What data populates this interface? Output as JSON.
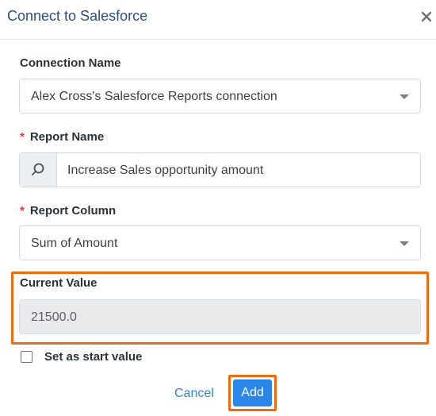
{
  "dialog": {
    "title": "Connect to Salesforce"
  },
  "form": {
    "connection": {
      "label": "Connection Name",
      "value": "Alex Cross's Salesforce Reports connection"
    },
    "report_name": {
      "required_mark": "*",
      "label": "Report Name",
      "value": "Increase Sales opportunity amount"
    },
    "report_column": {
      "required_mark": "*",
      "label": "Report Column",
      "value": "Sum of Amount"
    },
    "current_value": {
      "label": "Current Value",
      "value": "21500.0"
    },
    "start_value": {
      "label": "Set as start value",
      "checked": false
    }
  },
  "actions": {
    "cancel_label": "Cancel",
    "add_label": "Add"
  },
  "colors": {
    "accent": "#2a86e8",
    "highlight": "#f26a0e",
    "required": "#e23b3b",
    "title": "#2f4e7b"
  }
}
